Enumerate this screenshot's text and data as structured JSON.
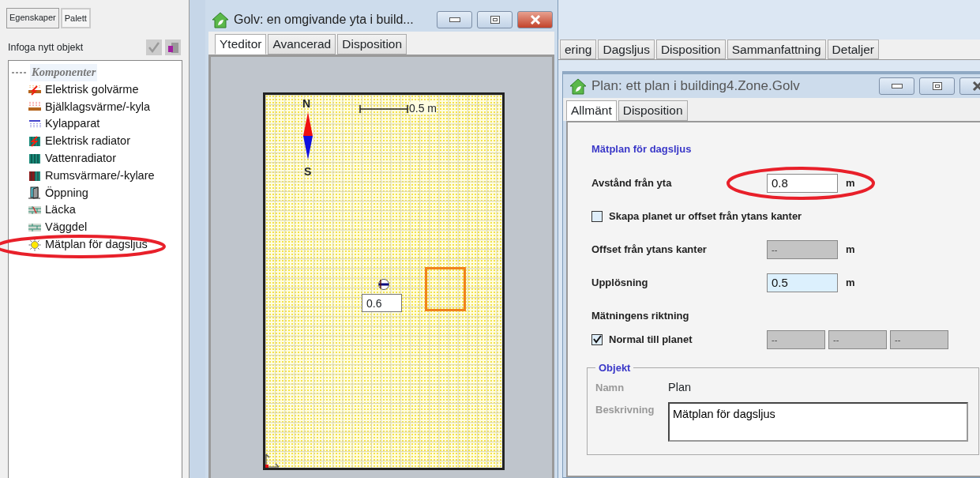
{
  "left_panel": {
    "tabs": [
      {
        "label": "Egenskaper",
        "selected": false
      },
      {
        "label": "Palett",
        "selected": true
      }
    ],
    "header": "Infoga nytt objekt",
    "tree": {
      "group": "Komponenter",
      "items": [
        {
          "label": "Elektrisk golvärme",
          "kind": "floor-heating",
          "circled": false
        },
        {
          "label": "Bjälklagsvärme/-kyla",
          "kind": "slab",
          "circled": false
        },
        {
          "label": "Kylapparat",
          "kind": "cooler",
          "circled": false
        },
        {
          "label": "Elektrisk radiator",
          "kind": "electric-radiator",
          "circled": false
        },
        {
          "label": "Vattenradiator",
          "kind": "water-radiator",
          "circled": false
        },
        {
          "label": "Rumsvärmare/-kylare",
          "kind": "room-heater",
          "circled": false
        },
        {
          "label": "Öppning",
          "kind": "opening",
          "circled": false
        },
        {
          "label": "Läcka",
          "kind": "leak",
          "circled": false
        },
        {
          "label": "Väggdel",
          "kind": "wall-part",
          "circled": false
        },
        {
          "label": "Mätplan för dagsljus",
          "kind": "daylight",
          "circled": true
        }
      ]
    }
  },
  "surface_window": {
    "title": "Golv: en omgivande yta i build...",
    "tabs": [
      {
        "label": "Yteditor",
        "selected": true
      },
      {
        "label": "Avancerad",
        "selected": false
      },
      {
        "label": "Disposition",
        "selected": false
      }
    ],
    "canvas": {
      "north": "N",
      "south": "S",
      "scale": "0.5 m",
      "sensor_label": "0.6"
    }
  },
  "back_tabs": [
    {
      "label": "ering"
    },
    {
      "label": "Dagsljus"
    },
    {
      "label": "Disposition"
    },
    {
      "label": "Sammanfattning"
    },
    {
      "label": "Detaljer"
    }
  ],
  "plane_window": {
    "title": "Plan: ett plan i building4.Zone.Golv",
    "tabs": [
      {
        "label": "Allmänt",
        "selected": true
      },
      {
        "label": "Disposition",
        "selected": false
      }
    ],
    "heading": "Mätplan för dagsljus",
    "rows": [
      {
        "kind": "field",
        "label": "Avstånd från yta",
        "value": "0.8",
        "unit": "m",
        "disabled": false,
        "focused": false,
        "circled": true
      },
      {
        "kind": "checkbox",
        "label": "Skapa planet ur offset från ytans kanter",
        "checked": false
      },
      {
        "kind": "field",
        "label": "Offset från ytans kanter",
        "value": "--",
        "unit": "m",
        "disabled": true,
        "focused": false,
        "circled": false
      },
      {
        "kind": "field",
        "label": "Upplösning",
        "value": "0.5",
        "unit": "m",
        "disabled": false,
        "focused": true,
        "circled": false
      },
      {
        "kind": "heading",
        "label": "Mätningens riktning"
      },
      {
        "kind": "checkbox-fields",
        "label": "Normal till planet",
        "checked": true,
        "values": [
          "--",
          "--",
          "--"
        ]
      }
    ],
    "object_group": {
      "legend": "Objekt",
      "name_label": "Namn",
      "name": "Plan",
      "description_label": "Beskrivning",
      "description": "Mätplan för dagsljus"
    }
  }
}
